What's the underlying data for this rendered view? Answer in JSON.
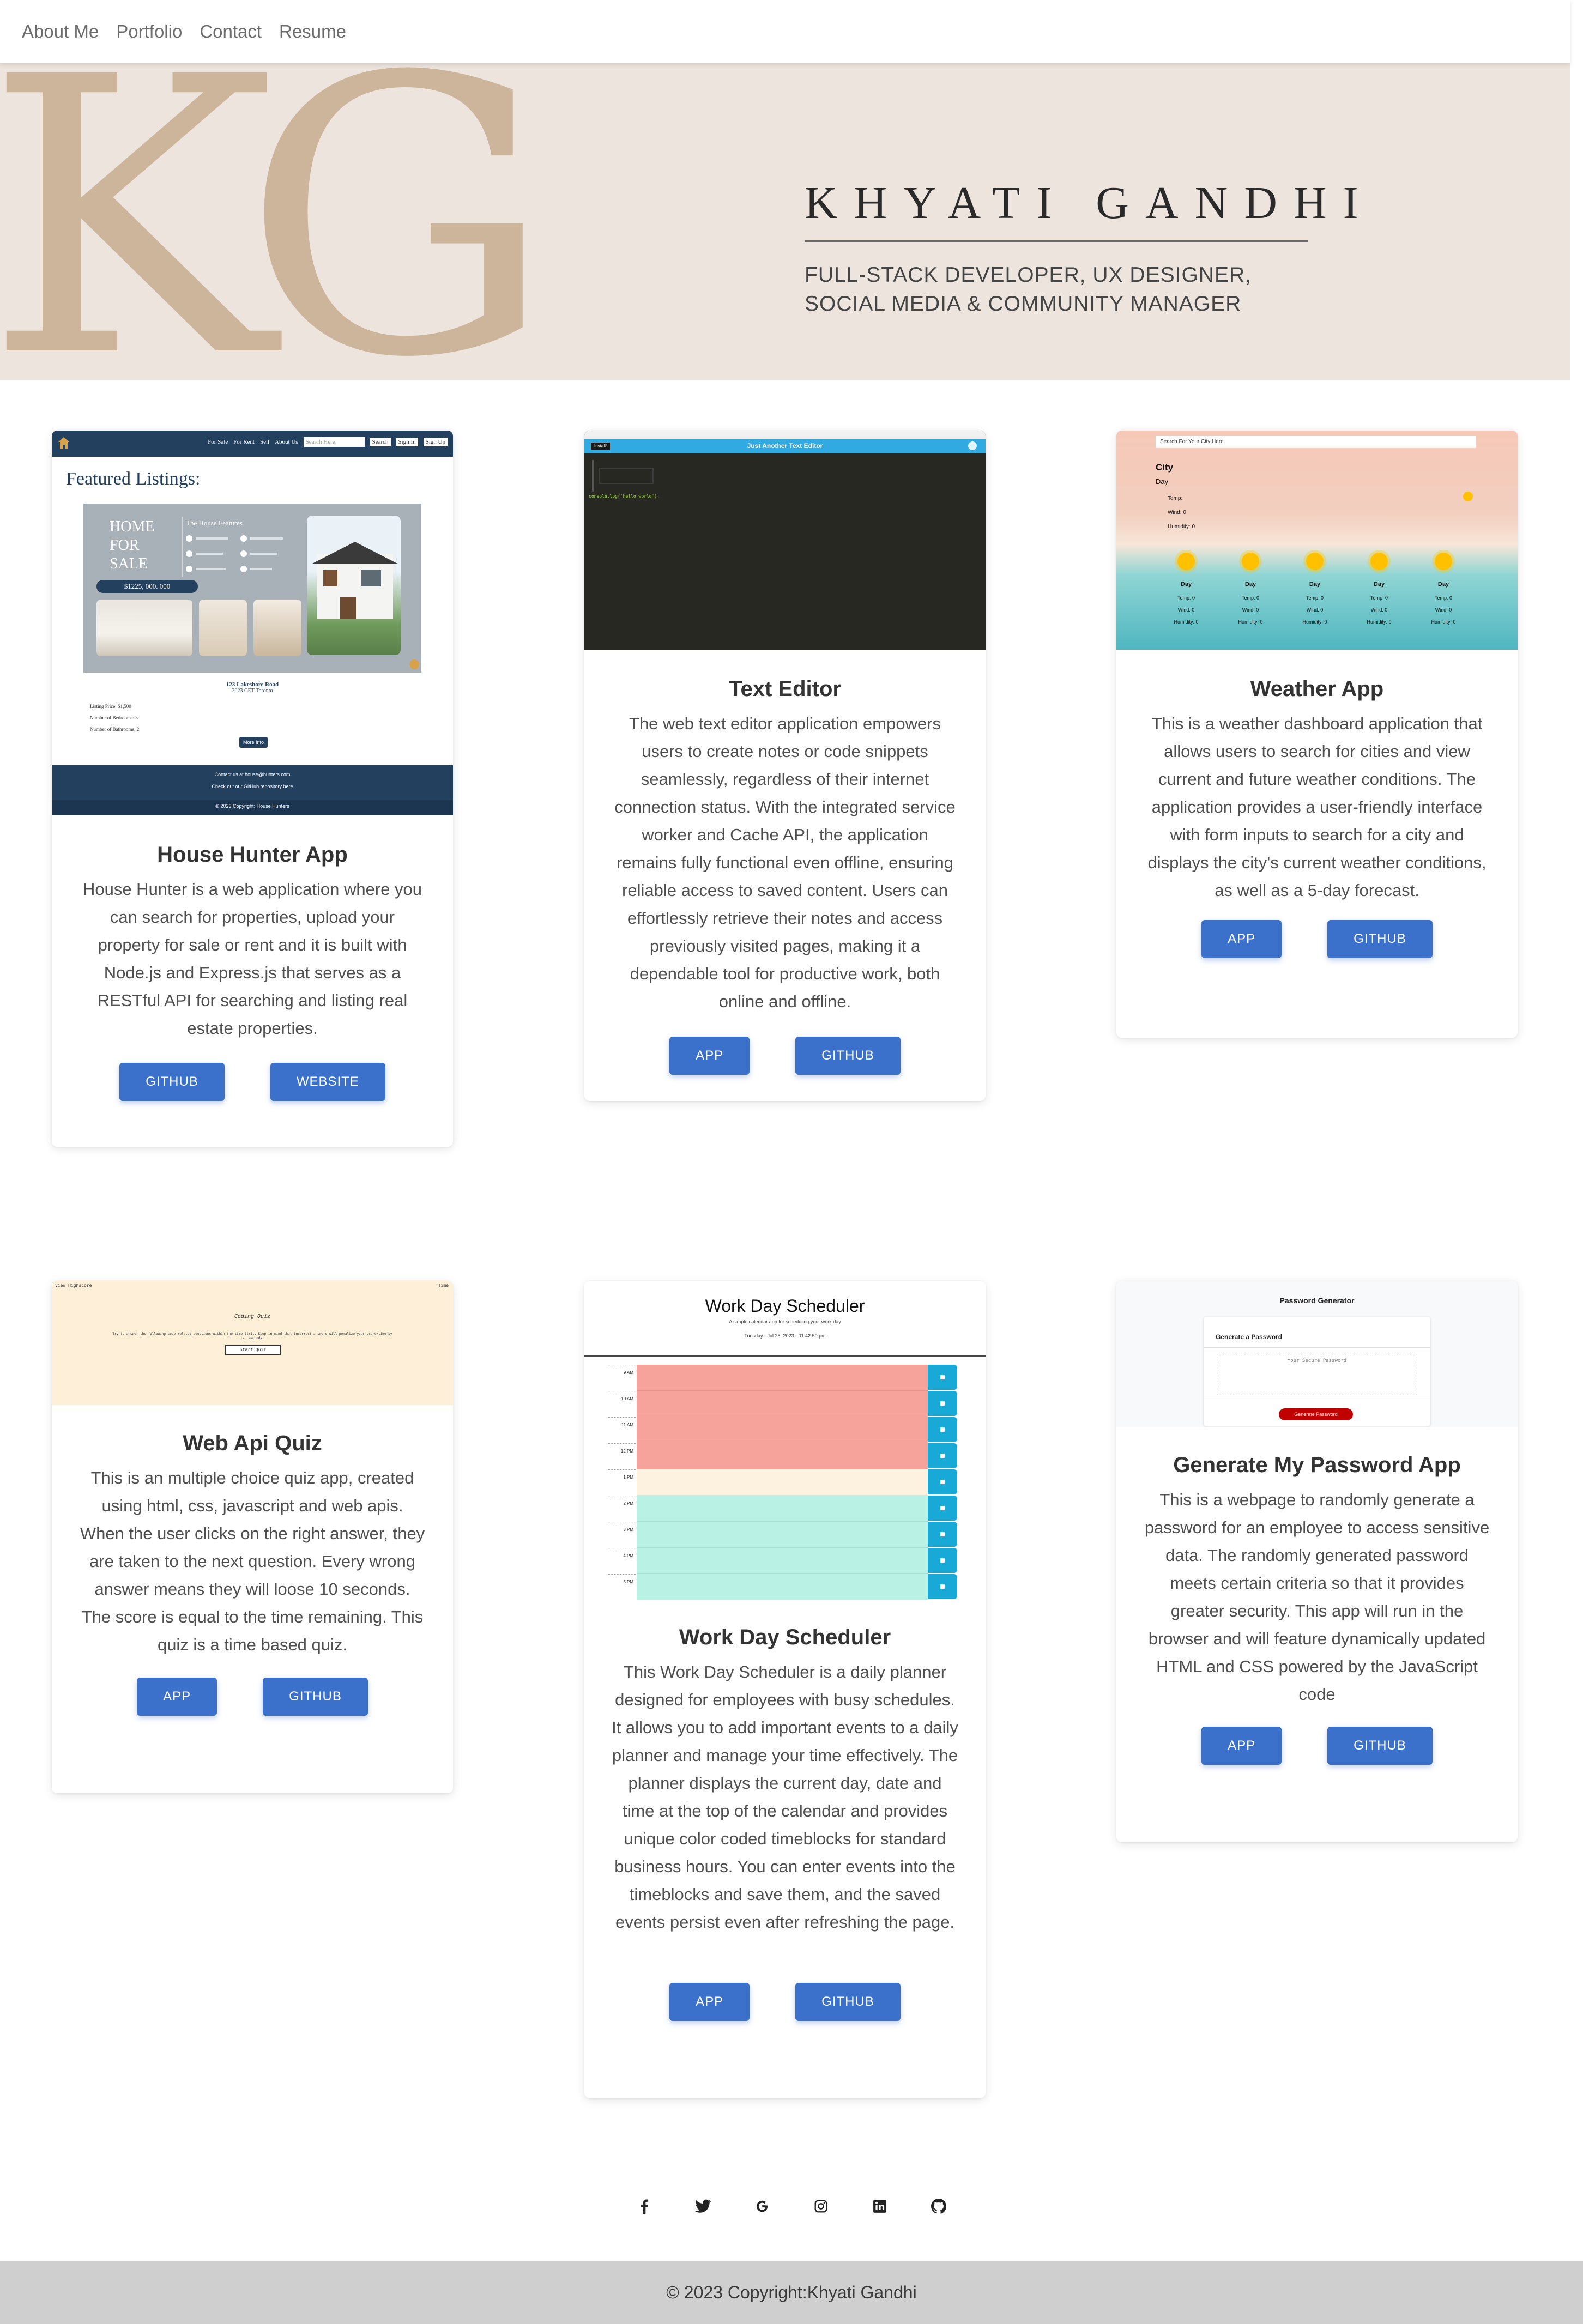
{
  "nav": {
    "items": [
      "About Me",
      "Portfolio",
      "Contact",
      "Resume"
    ]
  },
  "hero": {
    "monogram": "KG",
    "name": "KHYATI GANDHI",
    "subtitle_line1": "FULL-STACK DEVELOPER, UX DESIGNER,",
    "subtitle_line2": "SOCIAL MEDIA & COMMUNITY MANAGER"
  },
  "projects": [
    {
      "title": "House Hunter App",
      "description": "House Hunter is a web application where you can search for properties, upload your property for sale or rent and it is built with Node.js and Express.js that serves as a RESTful API for searching and listing real estate properties.",
      "buttons": [
        "GITHUB",
        "WEBSITE"
      ],
      "preview": {
        "heading": "Featured Listings:",
        "menu": [
          "For Sale",
          "For Rent",
          "Sell",
          "About Us"
        ],
        "search_placeholder": "Search Here",
        "search_button": "Search",
        "auth": [
          "Sign In",
          "Sign Up"
        ],
        "banner": [
          "HOME",
          "FOR",
          "SALE"
        ],
        "price": "$1225, 000. 000",
        "features_title": "The House Features",
        "address": "123 Lakeshore Road",
        "city": "2023 CET Toronto",
        "details": [
          "Listing Price: $1,500",
          "Number of Bedrooms: 3",
          "Number of Bathrooms: 2"
        ],
        "more_button": "More Info",
        "footer_contact": "Contact us at house@hunters.com",
        "footer_repo": "Check out our GitHub repository here",
        "footer_copy": "© 2023 Copyright: House Hunters"
      }
    },
    {
      "title": "Text Editor",
      "description": "The web text editor application empowers users to create notes or code snippets seamlessly, regardless of their internet connection status. With the integrated service worker and Cache API, the application remains fully functional even offline, ensuring reliable access to saved content. Users can effortlessly retrieve their notes and access previously visited pages, making it a dependable tool for productive work, both online and offline.",
      "buttons": [
        "APP",
        "GITHUB"
      ],
      "preview": {
        "header": "Just Another Text Editor",
        "install": "Install!",
        "code": "console.log('hello world');"
      }
    },
    {
      "title": "Weather App",
      "description": "This is a weather dashboard application that allows users to search for cities and view current and future weather conditions. The application provides a user-friendly interface with form inputs to search for a city and displays the city's current weather conditions, as well as a 5-day forecast.",
      "buttons": [
        "APP",
        "GITHUB"
      ],
      "preview": {
        "search_placeholder": "Search For Your City Here",
        "city": "City",
        "day": "Day",
        "rows": [
          "Temp:",
          "Wind: 0",
          "Humidity: 0"
        ],
        "forecast_day": "Day",
        "forecast_rows": [
          "Temp: 0",
          "Wind: 0",
          "Humidity: 0"
        ]
      }
    },
    {
      "title": "Web Api Quiz",
      "description": "This is an multiple choice quiz app, created using html, css, javascript and web apis. When the user clicks on the right answer, they are taken to the next question. Every wrong answer means they will loose 10 seconds. The score is equal to the time remaining. This quiz is a time based quiz.",
      "buttons": [
        "APP",
        "GITHUB"
      ],
      "preview": {
        "left": "View Highscore",
        "right": "Time",
        "heading": "Coding Quiz",
        "body": "Try to answer the following code-related questions within the time limit. Keep in mind that incorrect answers will penalize your score/time by ten seconds!",
        "start": "Start Quiz"
      }
    },
    {
      "title": "Work Day Scheduler",
      "description": "This Work Day Scheduler is a daily planner designed for employees with busy schedules. It allows you to add important events to a daily planner and manage your time effectively. The planner displays the current day, date and time at the top of the calendar and provides unique color coded timeblocks for standard business hours. You can enter events into the timeblocks and save them, and the saved events persist even after refreshing the page.",
      "buttons": [
        "APP",
        "GITHUB"
      ],
      "preview": {
        "heading": "Work Day Scheduler",
        "sub": "A simple calendar app for scheduling your work day",
        "date": "Tuesday - Jul 25, 2023 - 01:42:50 pm",
        "hours": [
          "9 AM",
          "10 AM",
          "11 AM",
          "12 PM",
          "1 PM",
          "2 PM",
          "3 PM",
          "4 PM",
          "5 PM"
        ],
        "states": [
          "past",
          "past",
          "past",
          "past",
          "present",
          "future",
          "future",
          "future",
          "future"
        ]
      }
    },
    {
      "title": "Generate My Password App",
      "description": "This is a webpage to randomly generate a password for an employee to access sensitive data. The randomly generated password meets certain criteria so that it provides greater security. This app will run in the browser and will feature dynamically updated HTML and CSS powered by the JavaScript code",
      "buttons": [
        "APP",
        "GITHUB"
      ],
      "preview": {
        "heading": "Password Generator",
        "card_title": "Generate a Password",
        "placeholder": "Your Secure Password",
        "button": "Generate Password"
      }
    }
  ],
  "social": [
    "facebook-icon",
    "twitter-icon",
    "google-icon",
    "instagram-icon",
    "linkedin-icon",
    "github-icon"
  ],
  "footer": {
    "copyright": "© 2023 Copyright:Khyati Gandhi"
  },
  "colors": {
    "hero_bg": "#ece4dd",
    "monogram": "#ccb59b",
    "button": "#3b71ca",
    "footer_bg": "#cfcfcf",
    "past": "#f6a49b",
    "present": "#fdf1e0",
    "future": "#b9f2e4",
    "save": "#18a9d6"
  }
}
